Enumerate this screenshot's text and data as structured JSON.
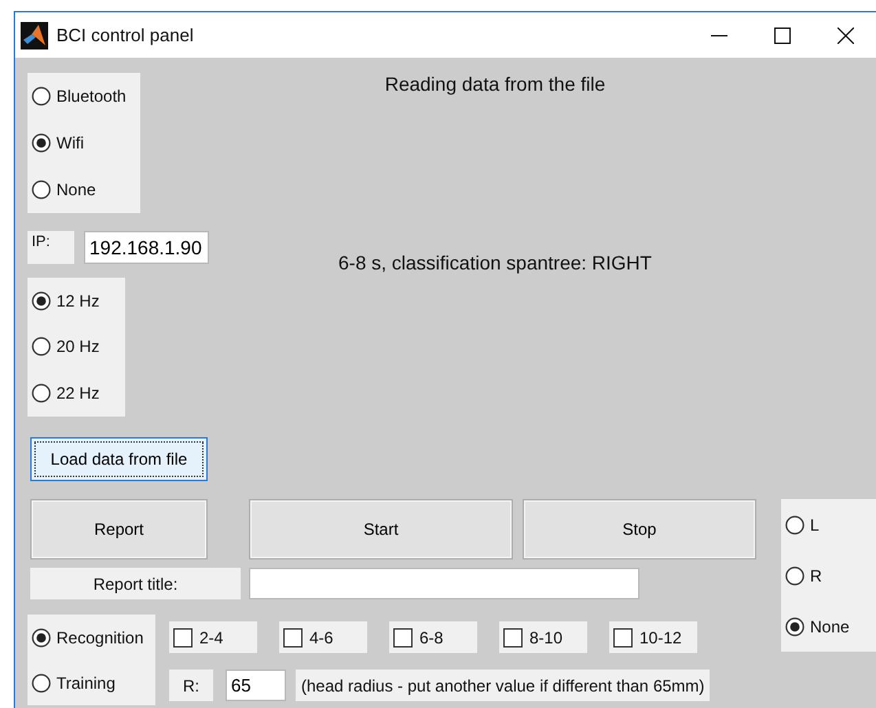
{
  "window": {
    "title": "BCI control panel"
  },
  "connection": [
    {
      "label": "Bluetooth",
      "selected": false
    },
    {
      "label": "Wifi",
      "selected": true
    },
    {
      "label": "None",
      "selected": false
    }
  ],
  "ip": {
    "label": "IP:",
    "value": "192.168.1.90"
  },
  "frequency": [
    {
      "label": "12 Hz",
      "selected": true
    },
    {
      "label": "20 Hz",
      "selected": false
    },
    {
      "label": "22 Hz",
      "selected": false
    }
  ],
  "load_button": "Load data from file",
  "status_texts": [
    "Reading data from the file",
    "6-8 s, classification spantree: RIGHT"
  ],
  "buttons": [
    "Report",
    "Start",
    "Stop"
  ],
  "report_title": {
    "label": "Report title:"
  },
  "mode": [
    {
      "label": "Recognition",
      "selected": true
    },
    {
      "label": "Training",
      "selected": false
    }
  ],
  "ranges": [
    {
      "label": "2-4",
      "checked": false
    },
    {
      "label": "4-6",
      "checked": false
    },
    {
      "label": "6-8",
      "checked": false
    },
    {
      "label": "8-10",
      "checked": false
    },
    {
      "label": "10-12",
      "checked": false
    }
  ],
  "radius": {
    "label": "R:",
    "value": "65",
    "hint": "(head radius - put another value if different than 65mm)"
  },
  "side": [
    {
      "label": "L",
      "selected": false
    },
    {
      "label": "R",
      "selected": false
    },
    {
      "label": "None",
      "selected": true
    }
  ]
}
